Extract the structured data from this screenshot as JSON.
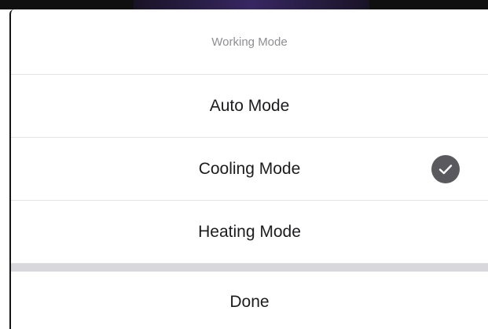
{
  "sheet": {
    "title": "Working Mode",
    "options": [
      {
        "label": "Auto Mode",
        "selected": false
      },
      {
        "label": "Cooling Mode",
        "selected": true
      },
      {
        "label": "Heating Mode",
        "selected": false
      }
    ],
    "done_label": "Done"
  },
  "icons": {
    "selected_indicator": "checkmark-circle-icon"
  },
  "colors": {
    "title_text": "#8e8e93",
    "option_text": "#1c1c1e",
    "check_fill": "#5a5a5e",
    "separator": "#d8d8dc"
  }
}
